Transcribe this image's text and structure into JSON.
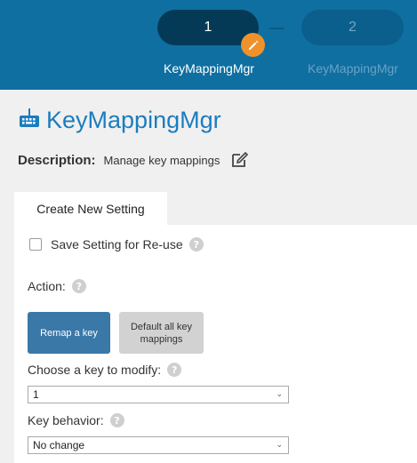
{
  "wizard": {
    "steps": [
      {
        "number": "1",
        "label": "KeyMappingMgr"
      },
      {
        "number": "2",
        "label": "KeyMappingMgr"
      }
    ]
  },
  "header": {
    "title": "KeyMappingMgr",
    "description_label": "Description:",
    "description_value": "Manage key mappings"
  },
  "tabs": {
    "active": "Create New Setting"
  },
  "form": {
    "save_setting_label": "Save Setting for Re-use",
    "save_setting_checked": false,
    "action_label": "Action:",
    "remap_button": "Remap a key",
    "default_button": "Default all key mappings",
    "key_label": "Choose a key to modify:",
    "key_value": "1",
    "behavior_label": "Key behavior:",
    "behavior_value": "No change"
  },
  "colors": {
    "header_bg": "#0f6fa0",
    "active_step": "#053a57",
    "inactive_step": "#0a5f8c",
    "accent_orange": "#f0922b",
    "title_blue": "#1a7dbf",
    "primary_button": "#3a78a8"
  }
}
